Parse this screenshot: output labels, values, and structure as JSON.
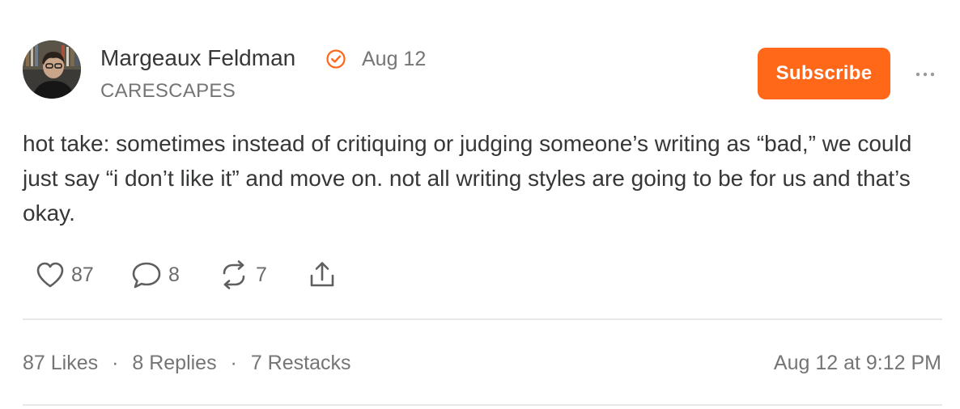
{
  "post": {
    "author_name": "Margeaux Feldman",
    "date": "Aug 12",
    "publication": "CARESCAPES",
    "body": "hot take: sometimes instead of critiquing or judging someone’s writing as “bad,” we could just say “i don’t like it” and move on. not all writing styles are going to be for us and that’s okay."
  },
  "header": {
    "subscribe_label": "Subscribe"
  },
  "actions": {
    "likes": "87",
    "replies": "8",
    "restacks": "7"
  },
  "stats": {
    "likes": "87 Likes",
    "replies": "8 Replies",
    "restacks": "7 Restacks",
    "separator": "·",
    "timestamp": "Aug 12 at 9:12 PM"
  },
  "colors": {
    "accent": "#ff6719",
    "text": "#363737",
    "muted": "#757575",
    "divider": "#e8e8e8"
  },
  "icons": {
    "verified": "verified-check-icon",
    "more": "ellipsis-icon",
    "like": "heart-icon",
    "reply": "comment-bubble-icon",
    "restack": "restack-arrows-icon",
    "share": "share-upload-icon"
  }
}
